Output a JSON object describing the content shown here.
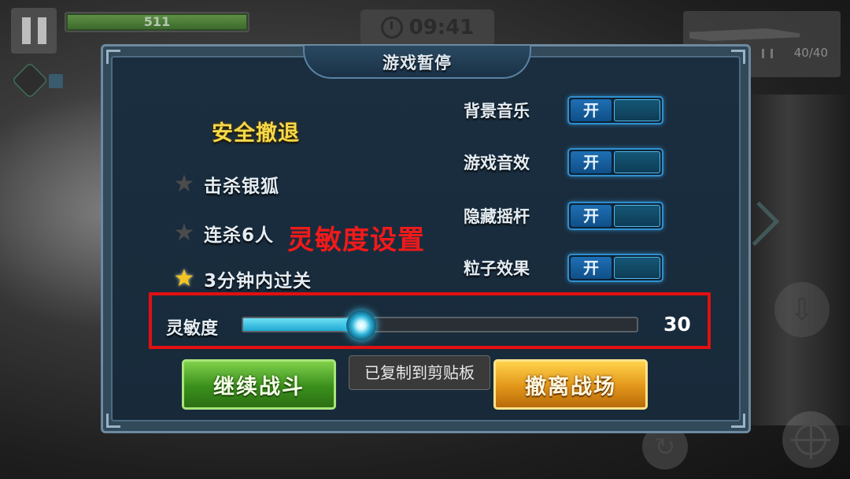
{
  "hud": {
    "health_value": "511",
    "timer": "09:41",
    "ammo": "40/40",
    "icons": [
      "pause-icon",
      "clock-icon",
      "rifle-icon",
      "ammo-icon",
      "crouch-icon",
      "reload-icon",
      "crosshair-icon"
    ]
  },
  "dialog": {
    "title": "游戏暂停",
    "mission": {
      "title": "安全撤退",
      "tasks": [
        {
          "label": "击杀银狐",
          "completed": false
        },
        {
          "label": "连杀6人",
          "completed": false
        },
        {
          "label": "3分钟内过关",
          "completed": true
        }
      ]
    },
    "settings": [
      {
        "label": "背景音乐",
        "state_label": "开",
        "on": true
      },
      {
        "label": "游戏音效",
        "state_label": "开",
        "on": true
      },
      {
        "label": "隐藏摇杆",
        "state_label": "开",
        "on": true
      },
      {
        "label": "粒子效果",
        "state_label": "开",
        "on": true
      }
    ],
    "sensitivity": {
      "label": "灵敏度",
      "value": "30",
      "level": 0.3
    },
    "buttons": {
      "continue_label": "继续战斗",
      "retreat_label": "撤离战场"
    }
  },
  "annotation": {
    "text": "灵敏度设置",
    "color": "#e11010"
  },
  "toast": {
    "text": "已复制到剪贴板"
  },
  "colors": {
    "accent": "#2f8fcf",
    "mission_title": "#f5d94a",
    "continue_button": "#3a8f1c",
    "retreat_button": "#e2951a"
  }
}
